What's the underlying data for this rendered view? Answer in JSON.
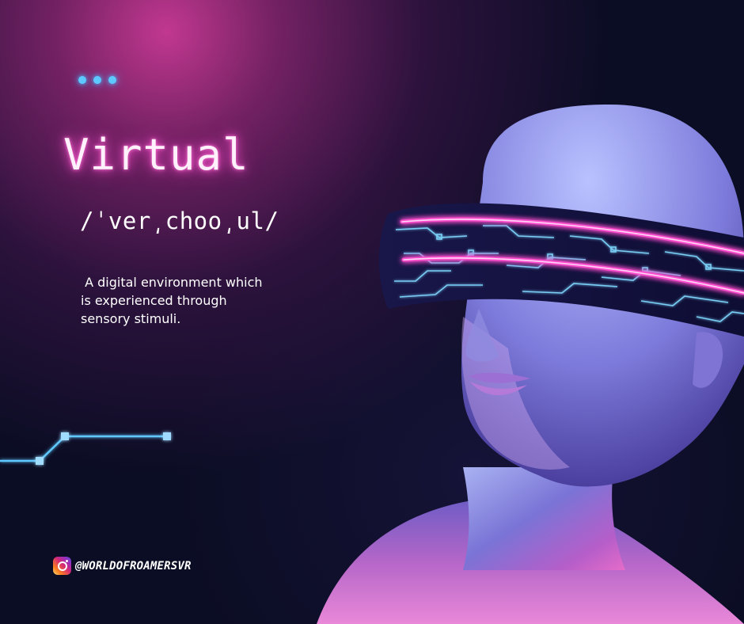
{
  "card": {
    "title": "Virtual",
    "phonetic": "/ˈver͵choo͵ul/",
    "description": " A digital environment which is experienced through sensory stimuli.",
    "social_icon": "instagram-icon",
    "social_handle": "@WORLDOFROAMERSVR"
  },
  "colors": {
    "background": "#0b0d24",
    "glow_pink": "#ff4fcf",
    "accent_blue": "#5ec8ff"
  }
}
